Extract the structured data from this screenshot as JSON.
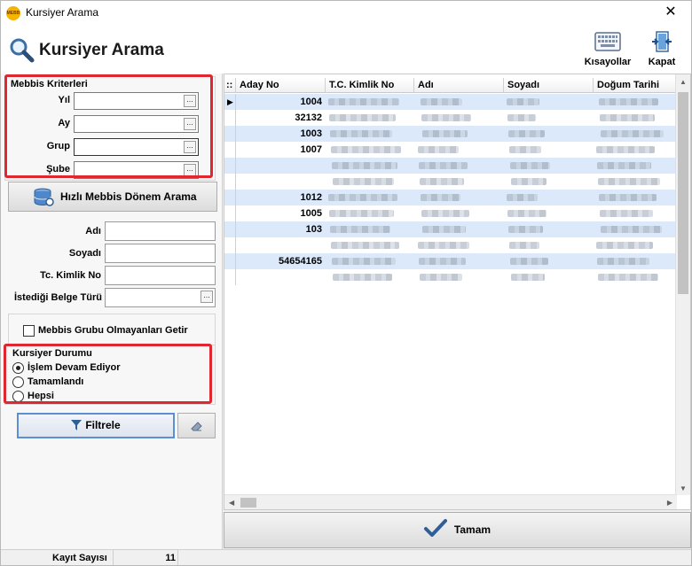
{
  "window": {
    "title": "Kursiyer Arama",
    "logo_text": "MEBB"
  },
  "header": {
    "title": "Kursiyer Arama",
    "shortcuts_label": "Kısayollar",
    "close_label": "Kapat"
  },
  "mebbis": {
    "title": "Mebbis Kriterleri",
    "year_label": "Yıl",
    "month_label": "Ay",
    "group_label": "Grup",
    "branch_label": "Şube",
    "year_value": "",
    "month_value": "",
    "group_value": "",
    "branch_value": "",
    "quick_search_label": "Hızlı Mebbis Dönem Arama"
  },
  "filters": {
    "first_name_label": "Adı",
    "last_name_label": "Soyadı",
    "tc_label": "Tc. Kimlik No",
    "doc_type_label": "İstediği Belge Türü",
    "first_name_value": "",
    "last_name_value": "",
    "tc_value": "",
    "doc_type_value": "",
    "no_group_label": "Mebbis Grubu Olmayanları Getir",
    "no_group_checked": false
  },
  "status": {
    "title": "Kursiyer Durumu",
    "options": [
      {
        "label": "İşlem Devam Ediyor",
        "checked": true
      },
      {
        "label": "Tamamlandı",
        "checked": false
      },
      {
        "label": "Hepsi",
        "checked": false
      }
    ]
  },
  "buttons": {
    "filter_label": "Filtrele",
    "ok_label": "Tamam"
  },
  "grid": {
    "columns": [
      "Aday No",
      "T.C. Kimlik No",
      "Adı",
      "Soyadı",
      "Doğum Tarihi"
    ],
    "rows": [
      {
        "aday_no": "1004"
      },
      {
        "aday_no": "32132"
      },
      {
        "aday_no": "1003"
      },
      {
        "aday_no": "1007"
      },
      {
        "aday_no": ""
      },
      {
        "aday_no": ""
      },
      {
        "aday_no": "1012"
      },
      {
        "aday_no": "1005"
      },
      {
        "aday_no": "103"
      },
      {
        "aday_no": ""
      },
      {
        "aday_no": "54654165"
      },
      {
        "aday_no": ""
      }
    ]
  },
  "footer": {
    "record_count_label": "Kayıt Sayısı",
    "record_count": "11"
  },
  "colors": {
    "accent_blue": "#5c8fd6",
    "highlight_red": "#e0262f",
    "row_alt": "#dbe9fa"
  }
}
